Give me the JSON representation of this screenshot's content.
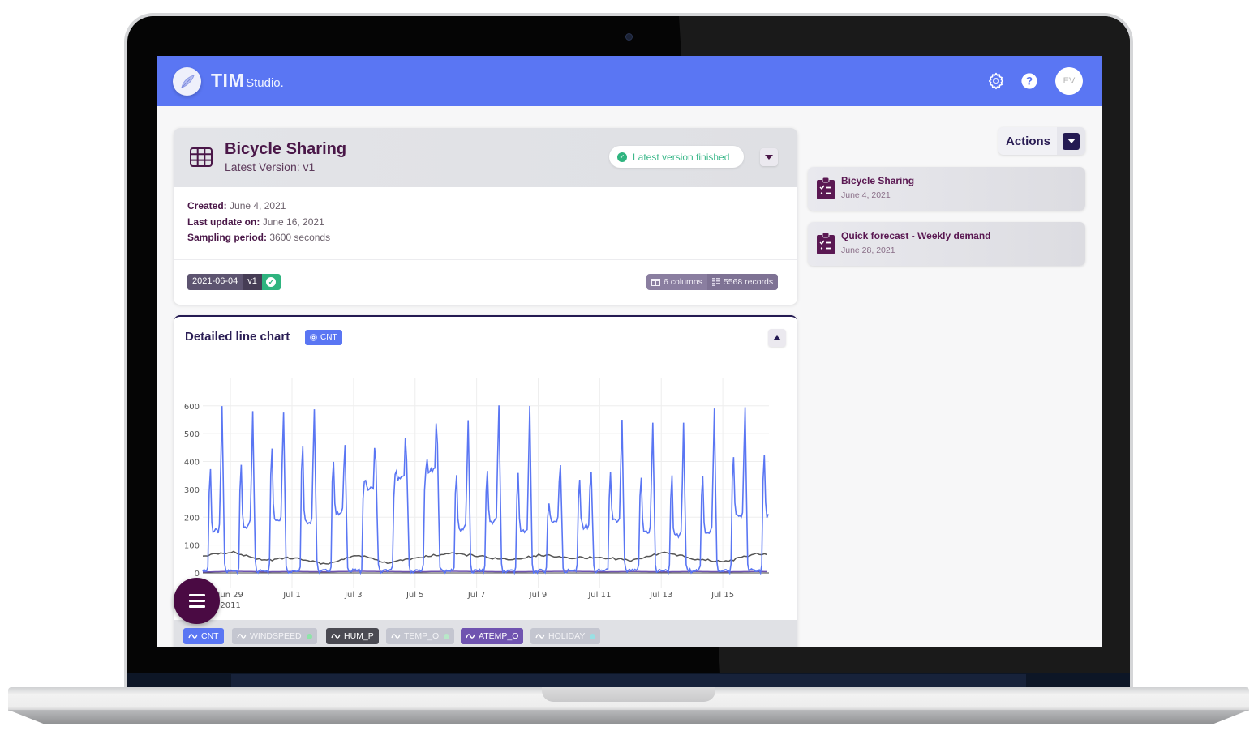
{
  "app": {
    "brand_main": "TIM",
    "brand_sub": "Studio.",
    "user_initials": "EV",
    "accent_color": "#5a76f3"
  },
  "dataset": {
    "title": "Bicycle Sharing",
    "latest_version": "Latest Version: v1",
    "status": "Latest version finished",
    "created_label": "Created:",
    "created_value": "June 4, 2021",
    "updated_label": "Last update on:",
    "updated_value": "June 16, 2021",
    "sampling_label": "Sampling period:",
    "sampling_value": "3600 seconds",
    "version_tag": {
      "date": "2021-06-04",
      "version": "v1"
    },
    "columns": "6 columns",
    "records": "5568 records"
  },
  "chart_panel": {
    "title": "Detailed line chart",
    "target_badge": "CNT",
    "legend": [
      {
        "label": "CNT",
        "bg": "#5a76f3",
        "active": true
      },
      {
        "label": "WINDSPEED",
        "bg": "#c4c6d0",
        "active": false,
        "dot": "#8ee4a8"
      },
      {
        "label": "HUM_P",
        "bg": "#4a4a52",
        "active": true
      },
      {
        "label": "TEMP_O",
        "bg": "#c4c6d0",
        "active": false,
        "dot": "#b8e8c8"
      },
      {
        "label": "ATEMP_O",
        "bg": "#7054b0",
        "active": true
      },
      {
        "label": "HOLIDAY",
        "bg": "#c4c6d0",
        "active": false,
        "dot": "#9ae0e4"
      }
    ]
  },
  "chart_data": {
    "type": "line",
    "title": "Detailed line chart",
    "xlabel": "",
    "ylabel": "",
    "ylim": [
      0,
      640
    ],
    "yticks": [
      0,
      100,
      200,
      300,
      400,
      500,
      600
    ],
    "xticks": [
      "Jun 29\n2011",
      "Jul 1",
      "Jul 3",
      "Jul 5",
      "Jul 7",
      "Jul 9",
      "Jul 11",
      "Jul 13",
      "Jul 15"
    ],
    "x_range_days": [
      -0.9,
      17.5
    ],
    "grid": true,
    "series": [
      {
        "name": "CNT",
        "color": "#5a76f3",
        "daily_peaks": [
          [
            445,
            600
          ],
          [
            455,
            575
          ],
          [
            540,
            585
          ],
          [
            555,
            590
          ],
          [
            490,
            455
          ],
          [
            400,
            395
          ],
          [
            415,
            410
          ],
          [
            445,
            455
          ],
          [
            430,
            540
          ],
          [
            445,
            600
          ],
          [
            425,
            590
          ],
          [
            300,
            390
          ],
          [
            400,
            360
          ],
          [
            425,
            545
          ],
          [
            415,
            540
          ],
          [
            420,
            530
          ],
          [
            415,
            585
          ],
          [
            505,
            590
          ]
        ],
        "daily_mid": [
          160,
          180,
          210,
          200,
          230,
          330,
          370,
          400,
          170,
          200,
          160,
          200,
          180,
          200,
          160,
          140,
          160,
          220
        ]
      },
      {
        "name": "HUM_P",
        "color": "#555555",
        "daily_values": [
          60,
          75,
          45,
          55,
          30,
          65,
          35,
          55,
          70,
          60,
          45,
          65,
          55,
          55,
          45,
          75,
          50,
          40,
          70,
          55
        ]
      },
      {
        "name": "ATEMP_O",
        "color": "#7054b0",
        "daily_values": [
          3,
          6,
          4,
          5,
          4,
          6,
          5,
          4,
          6,
          5,
          4,
          5,
          6,
          4,
          5,
          4,
          5,
          4,
          5,
          4
        ]
      }
    ]
  },
  "actions": {
    "label": "Actions"
  },
  "experiments": [
    {
      "title": "Bicycle Sharing",
      "date": "June 4, 2021"
    },
    {
      "title": "Quick forecast - Weekly demand",
      "date": "June 28, 2021"
    }
  ]
}
